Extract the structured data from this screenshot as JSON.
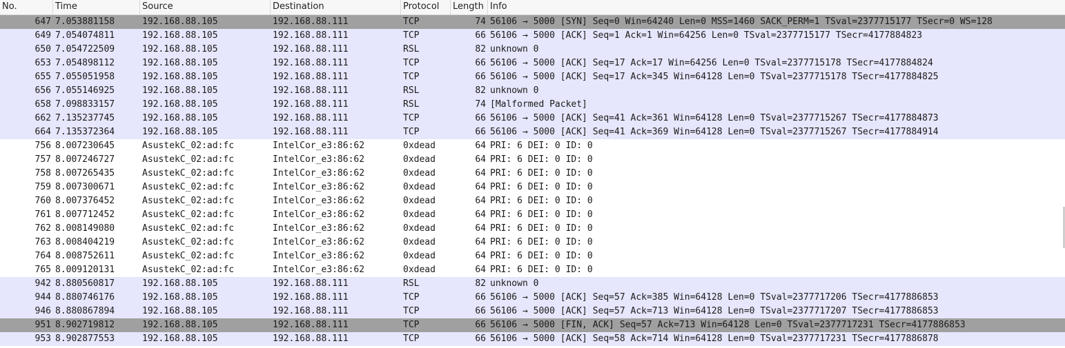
{
  "columns": {
    "no": "No.",
    "time": "Time",
    "source": "Source",
    "destination": "Destination",
    "protocol": "Protocol",
    "length": "Length",
    "info": "Info"
  },
  "packets": [
    {
      "no": "647",
      "time": "7.053881158",
      "source": "192.168.88.105",
      "destination": "192.168.88.111",
      "protocol": "TCP",
      "length": "74",
      "info": "56106 → 5000 [SYN] Seq=0 Win=64240 Len=0 MSS=1460 SACK_PERM=1 TSval=2377715177 TSecr=0 WS=128",
      "style": "syn"
    },
    {
      "no": "649",
      "time": "7.054074811",
      "source": "192.168.88.105",
      "destination": "192.168.88.111",
      "protocol": "TCP",
      "length": "66",
      "info": "56106 → 5000 [ACK] Seq=1 Ack=1 Win=64256 Len=0 TSval=2377715177 TSecr=4177884823",
      "style": "tcp"
    },
    {
      "no": "650",
      "time": "7.054722509",
      "source": "192.168.88.105",
      "destination": "192.168.88.111",
      "protocol": "RSL",
      "length": "82",
      "info": "unknown 0",
      "style": "tcp"
    },
    {
      "no": "653",
      "time": "7.054898112",
      "source": "192.168.88.105",
      "destination": "192.168.88.111",
      "protocol": "TCP",
      "length": "66",
      "info": "56106 → 5000 [ACK] Seq=17 Ack=17 Win=64256 Len=0 TSval=2377715178 TSecr=4177884824",
      "style": "tcp"
    },
    {
      "no": "655",
      "time": "7.055051958",
      "source": "192.168.88.105",
      "destination": "192.168.88.111",
      "protocol": "TCP",
      "length": "66",
      "info": "56106 → 5000 [ACK] Seq=17 Ack=345 Win=64128 Len=0 TSval=2377715178 TSecr=4177884825",
      "style": "tcp"
    },
    {
      "no": "656",
      "time": "7.055146925",
      "source": "192.168.88.105",
      "destination": "192.168.88.111",
      "protocol": "RSL",
      "length": "82",
      "info": "unknown 0",
      "style": "tcp"
    },
    {
      "no": "658",
      "time": "7.098833157",
      "source": "192.168.88.105",
      "destination": "192.168.88.111",
      "protocol": "RSL",
      "length": "74",
      "info": "[Malformed Packet]",
      "style": "tcp"
    },
    {
      "no": "662",
      "time": "7.135237745",
      "source": "192.168.88.105",
      "destination": "192.168.88.111",
      "protocol": "TCP",
      "length": "66",
      "info": "56106 → 5000 [ACK] Seq=41 Ack=361 Win=64128 Len=0 TSval=2377715267 TSecr=4177884873",
      "style": "tcp"
    },
    {
      "no": "664",
      "time": "7.135372364",
      "source": "192.168.88.105",
      "destination": "192.168.88.111",
      "protocol": "TCP",
      "length": "66",
      "info": "56106 → 5000 [ACK] Seq=41 Ack=369 Win=64128 Len=0 TSval=2377715267 TSecr=4177884914",
      "style": "tcp"
    },
    {
      "no": "756",
      "time": "8.007230645",
      "source": "AsustekC_02:ad:fc",
      "destination": "IntelCor_e3:86:62",
      "protocol": "0xdead",
      "length": "64",
      "info": "PRI: 6  DEI: 0  ID: 0",
      "style": "other"
    },
    {
      "no": "757",
      "time": "8.007246727",
      "source": "AsustekC_02:ad:fc",
      "destination": "IntelCor_e3:86:62",
      "protocol": "0xdead",
      "length": "64",
      "info": "PRI: 6  DEI: 0  ID: 0",
      "style": "other"
    },
    {
      "no": "758",
      "time": "8.007265435",
      "source": "AsustekC_02:ad:fc",
      "destination": "IntelCor_e3:86:62",
      "protocol": "0xdead",
      "length": "64",
      "info": "PRI: 6  DEI: 0  ID: 0",
      "style": "other"
    },
    {
      "no": "759",
      "time": "8.007300671",
      "source": "AsustekC_02:ad:fc",
      "destination": "IntelCor_e3:86:62",
      "protocol": "0xdead",
      "length": "64",
      "info": "PRI: 6  DEI: 0  ID: 0",
      "style": "other"
    },
    {
      "no": "760",
      "time": "8.007376452",
      "source": "AsustekC_02:ad:fc",
      "destination": "IntelCor_e3:86:62",
      "protocol": "0xdead",
      "length": "64",
      "info": "PRI: 6  DEI: 0  ID: 0",
      "style": "other"
    },
    {
      "no": "761",
      "time": "8.007712452",
      "source": "AsustekC_02:ad:fc",
      "destination": "IntelCor_e3:86:62",
      "protocol": "0xdead",
      "length": "64",
      "info": "PRI: 6  DEI: 0  ID: 0",
      "style": "other"
    },
    {
      "no": "762",
      "time": "8.008149080",
      "source": "AsustekC_02:ad:fc",
      "destination": "IntelCor_e3:86:62",
      "protocol": "0xdead",
      "length": "64",
      "info": "PRI: 6  DEI: 0  ID: 0",
      "style": "other"
    },
    {
      "no": "763",
      "time": "8.008404219",
      "source": "AsustekC_02:ad:fc",
      "destination": "IntelCor_e3:86:62",
      "protocol": "0xdead",
      "length": "64",
      "info": "PRI: 6  DEI: 0  ID: 0",
      "style": "other"
    },
    {
      "no": "764",
      "time": "8.008752611",
      "source": "AsustekC_02:ad:fc",
      "destination": "IntelCor_e3:86:62",
      "protocol": "0xdead",
      "length": "64",
      "info": "PRI: 6  DEI: 0  ID: 0",
      "style": "other"
    },
    {
      "no": "765",
      "time": "8.009120131",
      "source": "AsustekC_02:ad:fc",
      "destination": "IntelCor_e3:86:62",
      "protocol": "0xdead",
      "length": "64",
      "info": "PRI: 6  DEI: 0  ID: 0",
      "style": "other"
    },
    {
      "no": "942",
      "time": "8.880560817",
      "source": "192.168.88.105",
      "destination": "192.168.88.111",
      "protocol": "RSL",
      "length": "82",
      "info": "unknown 0",
      "style": "tcp"
    },
    {
      "no": "944",
      "time": "8.880746176",
      "source": "192.168.88.105",
      "destination": "192.168.88.111",
      "protocol": "TCP",
      "length": "66",
      "info": "56106 → 5000 [ACK] Seq=57 Ack=385 Win=64128 Len=0 TSval=2377717206 TSecr=4177886853",
      "style": "tcp"
    },
    {
      "no": "946",
      "time": "8.880867894",
      "source": "192.168.88.105",
      "destination": "192.168.88.111",
      "protocol": "TCP",
      "length": "66",
      "info": "56106 → 5000 [ACK] Seq=57 Ack=713 Win=64128 Len=0 TSval=2377717207 TSecr=4177886853",
      "style": "tcp"
    },
    {
      "no": "951",
      "time": "8.902719812",
      "source": "192.168.88.105",
      "destination": "192.168.88.111",
      "protocol": "TCP",
      "length": "66",
      "info": "56106 → 5000 [FIN, ACK] Seq=57 Ack=713 Win=64128 Len=0 TSval=2377717231 TSecr=4177886853",
      "style": "fin"
    },
    {
      "no": "953",
      "time": "8.902877553",
      "source": "192.168.88.105",
      "destination": "192.168.88.111",
      "protocol": "TCP",
      "length": "66",
      "info": "56106 → 5000 [ACK] Seq=58 Ack=714 Win=64128 Len=0 TSval=2377717231 TSecr=4177886878",
      "style": "tcp"
    }
  ]
}
